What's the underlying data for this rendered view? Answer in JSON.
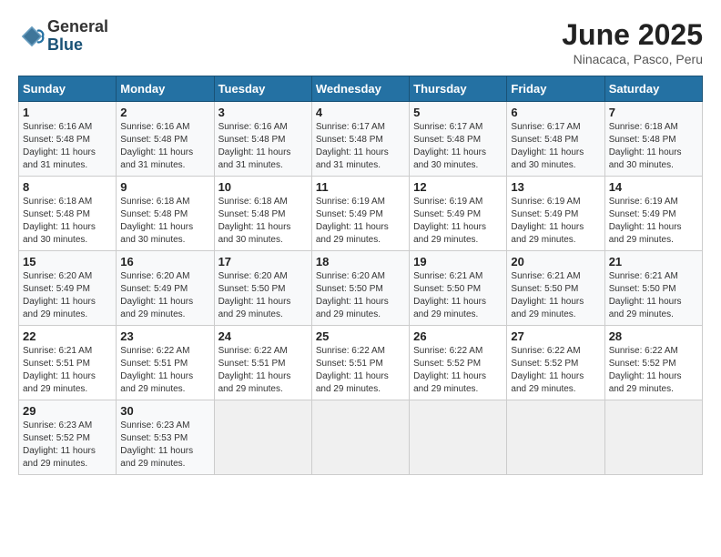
{
  "logo": {
    "general": "General",
    "blue": "Blue"
  },
  "title": "June 2025",
  "location": "Ninacaca, Pasco, Peru",
  "days_header": [
    "Sunday",
    "Monday",
    "Tuesday",
    "Wednesday",
    "Thursday",
    "Friday",
    "Saturday"
  ],
  "weeks": [
    [
      {
        "day": "1",
        "sunrise": "6:16 AM",
        "sunset": "5:48 PM",
        "daylight": "11 hours and 31 minutes."
      },
      {
        "day": "2",
        "sunrise": "6:16 AM",
        "sunset": "5:48 PM",
        "daylight": "11 hours and 31 minutes."
      },
      {
        "day": "3",
        "sunrise": "6:16 AM",
        "sunset": "5:48 PM",
        "daylight": "11 hours and 31 minutes."
      },
      {
        "day": "4",
        "sunrise": "6:17 AM",
        "sunset": "5:48 PM",
        "daylight": "11 hours and 31 minutes."
      },
      {
        "day": "5",
        "sunrise": "6:17 AM",
        "sunset": "5:48 PM",
        "daylight": "11 hours and 30 minutes."
      },
      {
        "day": "6",
        "sunrise": "6:17 AM",
        "sunset": "5:48 PM",
        "daylight": "11 hours and 30 minutes."
      },
      {
        "day": "7",
        "sunrise": "6:18 AM",
        "sunset": "5:48 PM",
        "daylight": "11 hours and 30 minutes."
      }
    ],
    [
      {
        "day": "8",
        "sunrise": "6:18 AM",
        "sunset": "5:48 PM",
        "daylight": "11 hours and 30 minutes."
      },
      {
        "day": "9",
        "sunrise": "6:18 AM",
        "sunset": "5:48 PM",
        "daylight": "11 hours and 30 minutes."
      },
      {
        "day": "10",
        "sunrise": "6:18 AM",
        "sunset": "5:48 PM",
        "daylight": "11 hours and 30 minutes."
      },
      {
        "day": "11",
        "sunrise": "6:19 AM",
        "sunset": "5:49 PM",
        "daylight": "11 hours and 29 minutes."
      },
      {
        "day": "12",
        "sunrise": "6:19 AM",
        "sunset": "5:49 PM",
        "daylight": "11 hours and 29 minutes."
      },
      {
        "day": "13",
        "sunrise": "6:19 AM",
        "sunset": "5:49 PM",
        "daylight": "11 hours and 29 minutes."
      },
      {
        "day": "14",
        "sunrise": "6:19 AM",
        "sunset": "5:49 PM",
        "daylight": "11 hours and 29 minutes."
      }
    ],
    [
      {
        "day": "15",
        "sunrise": "6:20 AM",
        "sunset": "5:49 PM",
        "daylight": "11 hours and 29 minutes."
      },
      {
        "day": "16",
        "sunrise": "6:20 AM",
        "sunset": "5:49 PM",
        "daylight": "11 hours and 29 minutes."
      },
      {
        "day": "17",
        "sunrise": "6:20 AM",
        "sunset": "5:50 PM",
        "daylight": "11 hours and 29 minutes."
      },
      {
        "day": "18",
        "sunrise": "6:20 AM",
        "sunset": "5:50 PM",
        "daylight": "11 hours and 29 minutes."
      },
      {
        "day": "19",
        "sunrise": "6:21 AM",
        "sunset": "5:50 PM",
        "daylight": "11 hours and 29 minutes."
      },
      {
        "day": "20",
        "sunrise": "6:21 AM",
        "sunset": "5:50 PM",
        "daylight": "11 hours and 29 minutes."
      },
      {
        "day": "21",
        "sunrise": "6:21 AM",
        "sunset": "5:50 PM",
        "daylight": "11 hours and 29 minutes."
      }
    ],
    [
      {
        "day": "22",
        "sunrise": "6:21 AM",
        "sunset": "5:51 PM",
        "daylight": "11 hours and 29 minutes."
      },
      {
        "day": "23",
        "sunrise": "6:22 AM",
        "sunset": "5:51 PM",
        "daylight": "11 hours and 29 minutes."
      },
      {
        "day": "24",
        "sunrise": "6:22 AM",
        "sunset": "5:51 PM",
        "daylight": "11 hours and 29 minutes."
      },
      {
        "day": "25",
        "sunrise": "6:22 AM",
        "sunset": "5:51 PM",
        "daylight": "11 hours and 29 minutes."
      },
      {
        "day": "26",
        "sunrise": "6:22 AM",
        "sunset": "5:52 PM",
        "daylight": "11 hours and 29 minutes."
      },
      {
        "day": "27",
        "sunrise": "6:22 AM",
        "sunset": "5:52 PM",
        "daylight": "11 hours and 29 minutes."
      },
      {
        "day": "28",
        "sunrise": "6:22 AM",
        "sunset": "5:52 PM",
        "daylight": "11 hours and 29 minutes."
      }
    ],
    [
      {
        "day": "29",
        "sunrise": "6:23 AM",
        "sunset": "5:52 PM",
        "daylight": "11 hours and 29 minutes."
      },
      {
        "day": "30",
        "sunrise": "6:23 AM",
        "sunset": "5:53 PM",
        "daylight": "11 hours and 29 minutes."
      },
      {
        "day": "",
        "sunrise": "",
        "sunset": "",
        "daylight": ""
      },
      {
        "day": "",
        "sunrise": "",
        "sunset": "",
        "daylight": ""
      },
      {
        "day": "",
        "sunrise": "",
        "sunset": "",
        "daylight": ""
      },
      {
        "day": "",
        "sunrise": "",
        "sunset": "",
        "daylight": ""
      },
      {
        "day": "",
        "sunrise": "",
        "sunset": "",
        "daylight": ""
      }
    ]
  ],
  "labels": {
    "sunrise": "Sunrise:",
    "sunset": "Sunset:",
    "daylight": "Daylight:"
  }
}
